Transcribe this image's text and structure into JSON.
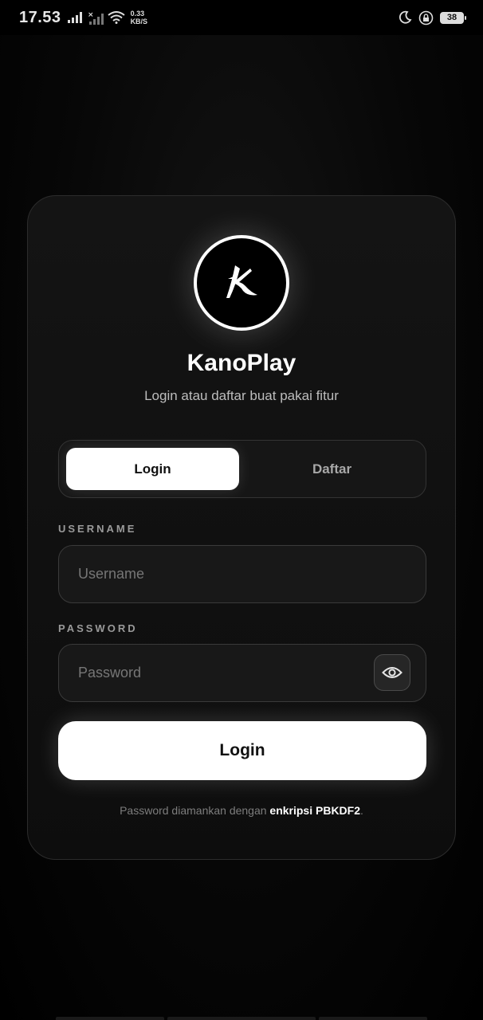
{
  "status_bar": {
    "time": "17.53",
    "net_speed_value": "0.33",
    "net_speed_unit": "KB/S",
    "battery": "38",
    "icons": [
      "signal-icon",
      "signal-off-icon",
      "wifi-icon",
      "moon-icon",
      "lock-rotation-icon",
      "battery-icon"
    ]
  },
  "brand": {
    "name": "KanoPlay",
    "subtitle": "Login atau daftar buat pakai fitur"
  },
  "tabs": {
    "login_label": "Login",
    "register_label": "Daftar",
    "active": "login"
  },
  "form": {
    "username_label": "USERNAME",
    "username_placeholder": "Username",
    "username_value": "",
    "password_label": "PASSWORD",
    "password_placeholder": "Password",
    "password_value": ""
  },
  "actions": {
    "login_button": "Login"
  },
  "footer": {
    "note_prefix": "Password diamankan dengan ",
    "note_bold": "enkripsi PBKDF2",
    "note_suffix": "."
  },
  "colors": {
    "background": "#000000",
    "card": "#121212",
    "accent": "#ffffff",
    "muted_text": "#9a9a9a"
  }
}
